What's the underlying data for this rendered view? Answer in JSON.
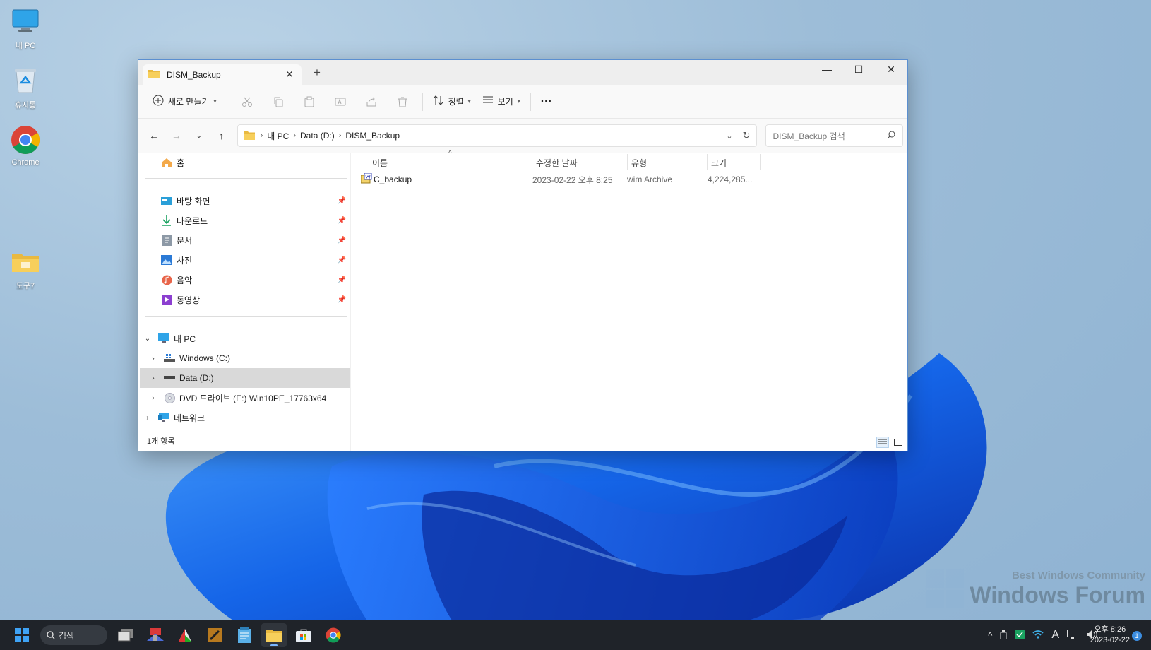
{
  "desktop": {
    "icons": [
      {
        "label": "내 PC",
        "icon": "monitor-icon"
      },
      {
        "label": "휴지통",
        "icon": "recycle-bin-icon"
      },
      {
        "label": "Chrome",
        "icon": "chrome-icon"
      },
      {
        "label": "도구7",
        "icon": "folder-icon"
      }
    ],
    "watermark": {
      "line1": "Best Windows Community",
      "line2": "Windows Forum"
    }
  },
  "window": {
    "tab_title": "DISM_Backup",
    "new_tab": "+",
    "controls": {
      "minimize": "—",
      "maximize": "☐",
      "close": "✕"
    },
    "toolbar": {
      "new_label": "새로 만들기",
      "sort_label": "정렬",
      "view_label": "보기",
      "more_label": "···"
    },
    "address": {
      "crumbs": [
        "내 PC",
        "Data (D:)",
        "DISM_Backup"
      ],
      "search_placeholder": "DISM_Backup 검색"
    },
    "sidebar": {
      "home": "홈",
      "quick": [
        {
          "label": "바탕 화면",
          "icon": "desktop-icon"
        },
        {
          "label": "다운로드",
          "icon": "download-icon"
        },
        {
          "label": "문서",
          "icon": "documents-icon"
        },
        {
          "label": "사진",
          "icon": "pictures-icon"
        },
        {
          "label": "음악",
          "icon": "music-icon"
        },
        {
          "label": "동영상",
          "icon": "videos-icon"
        }
      ],
      "this_pc": "내 PC",
      "drives": [
        {
          "label": "Windows (C:)",
          "icon": "windows-drive-icon"
        },
        {
          "label": "Data (D:)",
          "icon": "drive-icon",
          "selected": true
        },
        {
          "label": "DVD 드라이브 (E:) Win10PE_17763x64",
          "icon": "dvd-icon"
        }
      ],
      "network": "네트워크"
    },
    "columns": {
      "name": "이름",
      "modified": "수정한 날짜",
      "type": "유형",
      "size": "크기"
    },
    "files": [
      {
        "name": "C_backup",
        "modified": "2023-02-22 오후 8:25",
        "type": "wim Archive",
        "size": "4,224,285..."
      }
    ],
    "status": "1개 항목"
  },
  "taskbar": {
    "search_label": "검색",
    "clock_time": "오후 8:26",
    "clock_date": "2023-02-22",
    "notifications": "1",
    "ime": "A"
  }
}
